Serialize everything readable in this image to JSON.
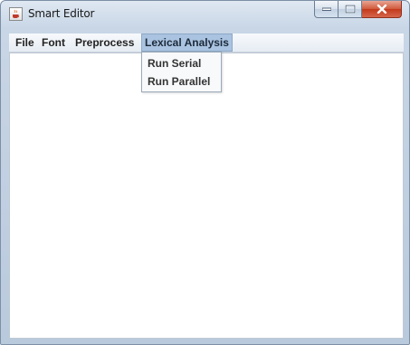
{
  "window": {
    "title": "Smart Editor",
    "icon": "java-cup-icon"
  },
  "caption": {
    "minimize_icon": "minimize-icon",
    "maximize_icon": "maximize-icon",
    "close_icon": "close-icon"
  },
  "menubar": {
    "items": [
      {
        "label": "File"
      },
      {
        "label": "Font"
      },
      {
        "label": "Preprocess"
      },
      {
        "label": "Lexical Analysis",
        "open": true
      }
    ]
  },
  "dropdown": {
    "items": [
      {
        "label": "Run Serial"
      },
      {
        "label": "Run Parallel"
      }
    ]
  },
  "editor": {
    "text": ""
  }
}
